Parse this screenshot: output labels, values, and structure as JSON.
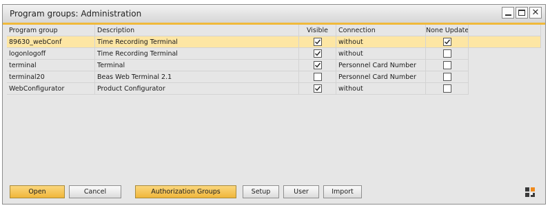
{
  "window": {
    "title": "Program groups: Administration",
    "minimize_icon": "minimize-icon",
    "maximize_icon": "maximize-icon",
    "close_icon": "close-icon",
    "close_glyph": "✕"
  },
  "table": {
    "columns": {
      "group": "Program group",
      "description": "Description",
      "visible": "Visible",
      "connection": "Connection",
      "none_update": "None Update"
    },
    "rows": [
      {
        "group": "89630_webConf",
        "description": "Time Recording Terminal",
        "visible": true,
        "connection": "without",
        "none_update": true,
        "selected": true
      },
      {
        "group": "logonlogoff",
        "description": "Time Recording Terminal",
        "visible": true,
        "connection": "without",
        "none_update": false,
        "selected": false
      },
      {
        "group": "terminal",
        "description": "Terminal",
        "visible": true,
        "connection": "Personnel Card Number",
        "none_update": false,
        "selected": false
      },
      {
        "group": "terminal20",
        "description": "Beas Web Terminal 2.1",
        "visible": false,
        "connection": "Personnel Card Number",
        "none_update": false,
        "selected": false
      },
      {
        "group": "WebConfigurator",
        "description": "Product Configurator",
        "visible": true,
        "connection": "without",
        "none_update": false,
        "selected": false
      }
    ]
  },
  "buttons": {
    "open": "Open",
    "cancel": "Cancel",
    "authorization_groups": "Authorization Groups",
    "setup": "Setup",
    "user": "User",
    "import": "Import"
  },
  "colors": {
    "accent": "#f0b93a",
    "selected_row": "#fde6a4",
    "background": "#e6e6e6"
  }
}
